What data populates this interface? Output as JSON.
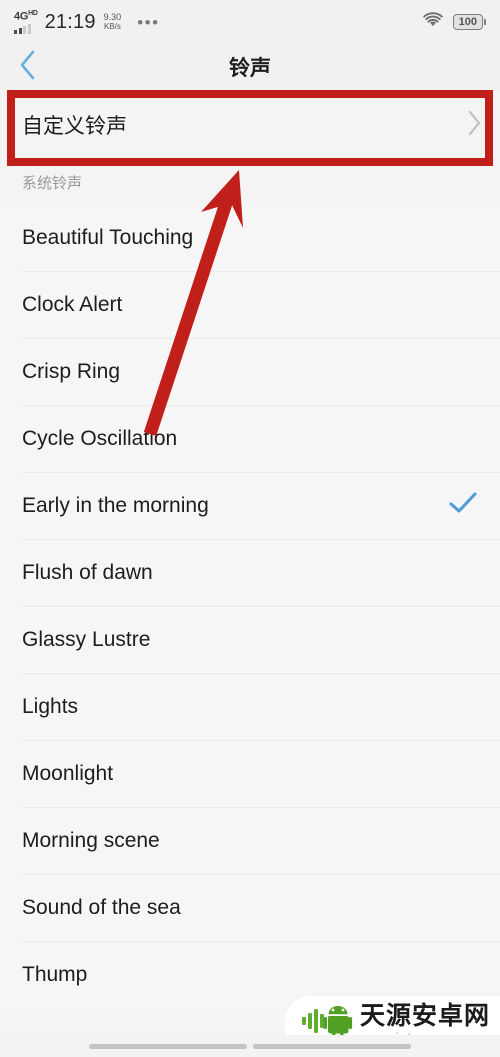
{
  "statusbar": {
    "network_type": "4G",
    "network_sup": "HD",
    "time": "21:19",
    "netspeed_value": "9.30",
    "netspeed_unit": "KB/s",
    "overflow_icon": "more-dots-icon",
    "wifi_icon": "wifi-icon",
    "battery_level": "100"
  },
  "header": {
    "back_icon": "chevron-left-icon",
    "title": "铃声"
  },
  "custom_row": {
    "label": "自定义铃声",
    "chevron_icon": "chevron-right-icon"
  },
  "section": {
    "title": "系统铃声"
  },
  "ringtones": [
    {
      "name": "Beautiful Touching",
      "selected": false
    },
    {
      "name": "Clock Alert",
      "selected": false
    },
    {
      "name": "Crisp Ring",
      "selected": false
    },
    {
      "name": "Cycle Oscillation",
      "selected": false
    },
    {
      "name": "Early in the morning",
      "selected": true
    },
    {
      "name": "Flush of dawn",
      "selected": false
    },
    {
      "name": "Glassy Lustre",
      "selected": false
    },
    {
      "name": "Lights",
      "selected": false
    },
    {
      "name": "Moonlight",
      "selected": false
    },
    {
      "name": "Morning scene",
      "selected": false
    },
    {
      "name": "Sound of the sea",
      "selected": false
    },
    {
      "name": "Thump",
      "selected": false
    }
  ],
  "watermark": {
    "site_name": "天源安卓网",
    "url": "www.jytyaz.com",
    "logo_icon": "android-robot-icon"
  },
  "annotations": {
    "highlight_box_color": "#c1201a",
    "arrow_color": "#c1201a"
  },
  "colors": {
    "accent_blue": "#4a9fdc",
    "check_blue": "#4d9ed6",
    "background": "#f5f5f5",
    "text_primary": "#1d1d1d",
    "text_secondary": "#9a9a9a"
  }
}
